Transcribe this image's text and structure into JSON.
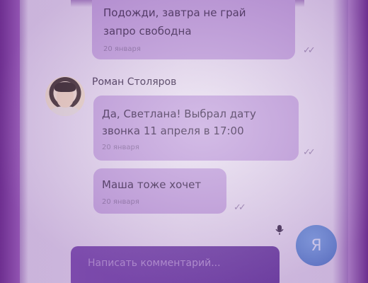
{
  "messages": [
    {
      "text_line1": "Подожди, завтра не грай",
      "text_line2": "запро свободна",
      "time": "20 января"
    },
    {
      "author": "Роман Столяров",
      "text_line1": "Да, Светлана! Выбрал дату",
      "text_line2": "звонка 11 апреля в 17:00",
      "time": "20 января"
    },
    {
      "text_line1": "Маша тоже хочет",
      "time": "20 января"
    }
  ],
  "composer": {
    "placeholder": "Написать комментарий..."
  },
  "send_button": {
    "avatar_letter": "Я"
  },
  "colors": {
    "bubble": "#c5a6de",
    "accent": "#5a86cc"
  }
}
